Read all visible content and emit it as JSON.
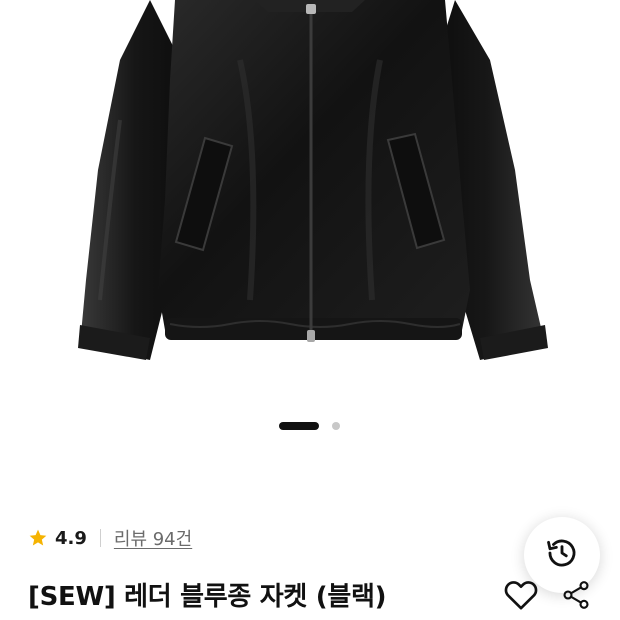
{
  "product": {
    "rating": "4.9",
    "review_label": "리뷰 94건",
    "title": "[SEW] 레더 블루종 자켓 (블랙)",
    "image_alt": "black leather blouson jacket"
  },
  "gallery": {
    "total_slides": 2,
    "active_slide": 1
  },
  "colors": {
    "star": "#f5b301",
    "text_primary": "#111111",
    "text_secondary": "#6b6b6b",
    "pager_active": "#111111",
    "pager_inactive": "#c8c8c8"
  },
  "icons": {
    "rating": "star-icon",
    "recent": "history-icon",
    "like": "heart-icon",
    "share": "share-icon"
  }
}
